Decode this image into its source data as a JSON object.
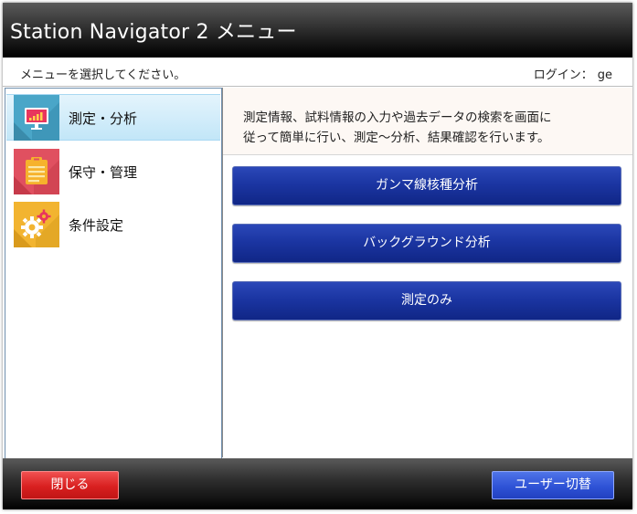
{
  "window": {
    "title": "Station Navigator 2 メニュー"
  },
  "info_bar": {
    "instruction": "メニューを選択してください。",
    "login_label": "ログイン：",
    "login_user": "ge"
  },
  "sidebar": {
    "items": [
      {
        "label": "測定・分析",
        "icon": "monitor-chart-icon",
        "color": "#4aa6c8",
        "selected": true
      },
      {
        "label": "保守・管理",
        "icon": "clipboard-icon",
        "color": "#e05060",
        "selected": false
      },
      {
        "label": "条件設定",
        "icon": "gears-icon",
        "color": "#f2b430",
        "selected": false
      }
    ]
  },
  "content": {
    "description_lines": [
      "測定情報、試料情報の入力や過去データの検索を画面に",
      "従って簡単に行い、測定〜分析、結果確認を行います。"
    ],
    "buttons": [
      {
        "label": "ガンマ線核種分析"
      },
      {
        "label": "バックグラウンド分析"
      },
      {
        "label": "測定のみ"
      }
    ]
  },
  "footer": {
    "close_label": "閉じる",
    "switch_user_label": "ユーザー切替"
  },
  "colors": {
    "accent_blue": "#1b35a2",
    "close_red": "#d92020",
    "switch_blue": "#2f53d6"
  }
}
